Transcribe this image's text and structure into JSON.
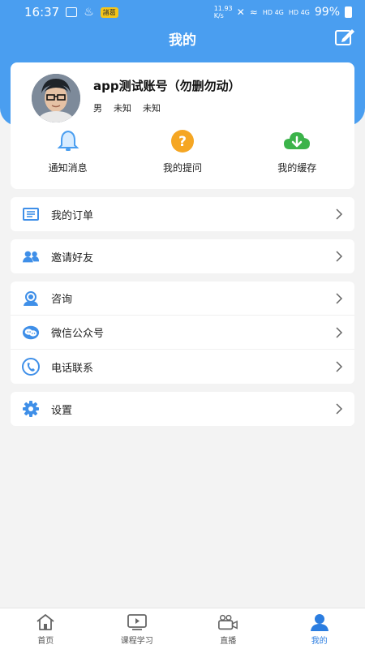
{
  "status_bar": {
    "time": "16:37",
    "badge": "諸葛",
    "net_speed": "11.93 K/s",
    "signal_1": "HD 4G",
    "signal_2": "HD 4G",
    "battery": "99%"
  },
  "header": {
    "title": "我的"
  },
  "profile": {
    "name": "app测试账号（勿删勿动）",
    "gender": "男",
    "field_2": "未知",
    "field_3": "未知"
  },
  "quick_actions": [
    {
      "label": "通知消息",
      "icon": "bell-icon"
    },
    {
      "label": "我的提问",
      "icon": "question-icon"
    },
    {
      "label": "我的缓存",
      "icon": "cloud-download-icon"
    }
  ],
  "menu": {
    "orders": "我的订单",
    "invite": "邀请好友",
    "consult": "咨询",
    "wechat": "微信公众号",
    "phone": "电话联系",
    "settings": "设置"
  },
  "tabs": [
    {
      "label": "首页",
      "icon": "home-icon"
    },
    {
      "label": "课程学习",
      "icon": "play-icon"
    },
    {
      "label": "直播",
      "icon": "camera-icon"
    },
    {
      "label": "我的",
      "icon": "user-icon",
      "active": true
    }
  ],
  "colors": {
    "primary": "#4a9ef0",
    "active_tab": "#2b7de0",
    "warn": "#f5a623",
    "green": "#3bb34a"
  }
}
